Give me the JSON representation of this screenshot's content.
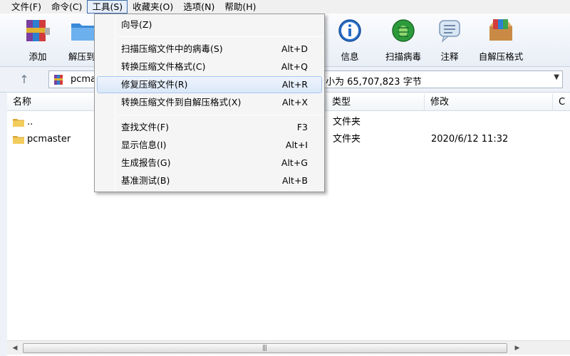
{
  "menubar": {
    "items": [
      "文件(F)",
      "命令(C)",
      "工具(S)",
      "收藏夹(O)",
      "选项(N)",
      "帮助(H)"
    ]
  },
  "toolbar": {
    "buttons": [
      {
        "label": "添加",
        "icon": "add-archive-icon"
      },
      {
        "label": "解压到",
        "icon": "extract-folder-icon"
      },
      {
        "label": "信息",
        "icon": "info-icon"
      },
      {
        "label": "扫描病毒",
        "icon": "virus-scan-icon"
      },
      {
        "label": "注释",
        "icon": "comment-icon"
      },
      {
        "label": "自解压格式",
        "icon": "sfx-box-icon"
      }
    ]
  },
  "address": {
    "up_icon": "↑",
    "path": "pcma",
    "info": "小为 65,707,823 字节"
  },
  "list": {
    "columns": [
      "名称",
      "类型",
      "修改",
      "C"
    ],
    "rows": [
      {
        "name": "..",
        "type": "文件夹",
        "modified": ""
      },
      {
        "name": "pcmaster",
        "type": "文件夹",
        "modified": "2020/6/12 11:32"
      }
    ]
  },
  "tools_menu": {
    "items": [
      {
        "label": "向导(Z)",
        "shortcut": ""
      },
      {
        "label": "扫描压缩文件中的病毒(S)",
        "shortcut": "Alt+D"
      },
      {
        "label": "转换压缩文件格式(C)",
        "shortcut": "Alt+Q"
      },
      {
        "label": "修复压缩文件(R)",
        "shortcut": "Alt+R"
      },
      {
        "label": "转换压缩文件到自解压格式(X)",
        "shortcut": "Alt+X"
      },
      {
        "label": "查找文件(F)",
        "shortcut": "F3"
      },
      {
        "label": "显示信息(I)",
        "shortcut": "Alt+I"
      },
      {
        "label": "生成报告(G)",
        "shortcut": "Alt+G"
      },
      {
        "label": "基准测试(B)",
        "shortcut": "Alt+B"
      }
    ]
  },
  "colors": {
    "highlight_border": "#a8c8ee",
    "menu_active_border": "#3d6ea8",
    "folder": "#e8c14b"
  }
}
